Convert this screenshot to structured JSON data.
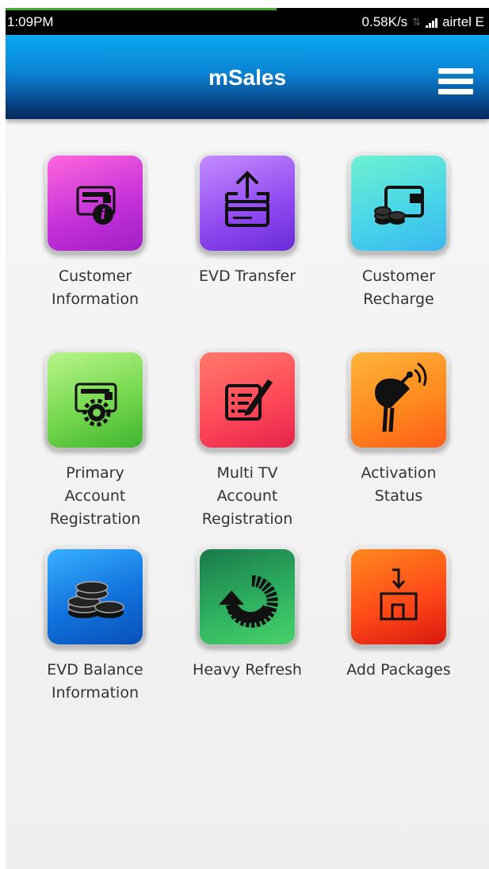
{
  "status_bar": {
    "time": "1:09PM",
    "speed": "0.58K/s",
    "transfer_indicator": "⇅",
    "carrier": "airtel E",
    "load_progress_percent": 56
  },
  "app_bar": {
    "title": "mSales",
    "menu_icon": "hamburger-menu-icon"
  },
  "tiles": [
    {
      "label": "Customer\nInformation",
      "icon": "customer-information-icon",
      "color": "#d03ed8"
    },
    {
      "label": "EVD Transfer",
      "icon": "evd-transfer-icon",
      "color": "#8f48f0"
    },
    {
      "label": "Customer\nRecharge",
      "icon": "customer-recharge-icon",
      "color": "#49d6e8"
    },
    {
      "label": "Primary\nAccount\nRegistration",
      "icon": "primary-account-registration-icon",
      "color": "#76d84f"
    },
    {
      "label": "Multi TV\nAccount\nRegistration",
      "icon": "multi-tv-account-registration-icon",
      "color": "#ff4a5a"
    },
    {
      "label": "Activation\nStatus",
      "icon": "activation-status-icon",
      "color": "#ff8a1e"
    },
    {
      "label": "EVD Balance\nInformation",
      "icon": "evd-balance-information-icon",
      "color": "#1172dd"
    },
    {
      "label": "Heavy Refresh",
      "icon": "heavy-refresh-icon",
      "color": "#2eb060"
    },
    {
      "label": "Add Packages",
      "icon": "add-packages-icon",
      "color": "#ff4a18"
    }
  ]
}
